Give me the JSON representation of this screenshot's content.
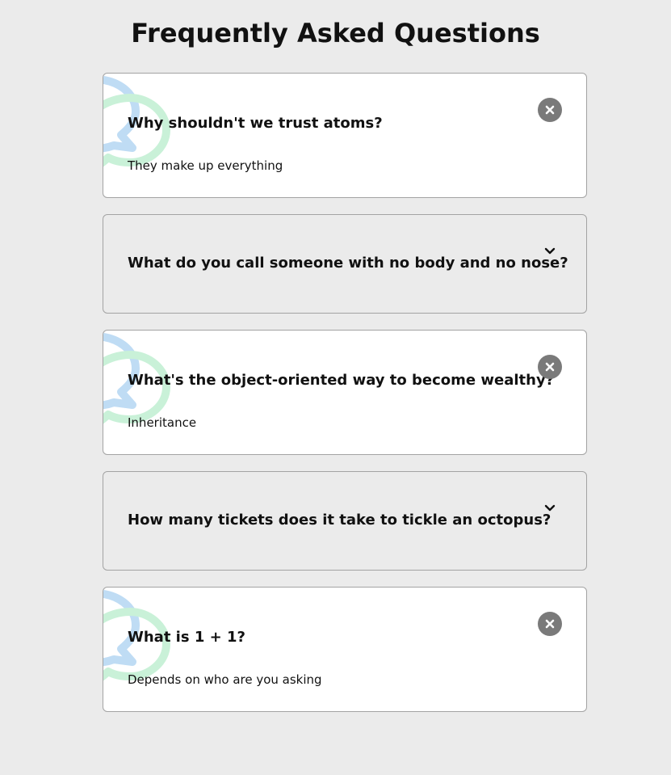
{
  "page": {
    "title": "Frequently Asked Questions"
  },
  "colors": {
    "background": "#ebebeb",
    "card_active_bg": "#ffffff",
    "card_border": "#a3a3a3",
    "toggle_close_bg": "#7a7a7a",
    "bubble_blue": "#bfdcf4",
    "bubble_green": "#c9f1d8",
    "text": "#111111"
  },
  "faq": {
    "items": [
      {
        "question": "Why shouldn't we trust atoms?",
        "answer": "They make up everything",
        "state": "expanded",
        "toggle_icon": "close-icon"
      },
      {
        "question": "What do you call someone with no body and no nose?",
        "answer": "",
        "state": "collapsed",
        "toggle_icon": "chevron-down-icon"
      },
      {
        "question": "What's the object-oriented way to become wealthy?",
        "answer": "Inheritance",
        "state": "expanded",
        "toggle_icon": "close-icon"
      },
      {
        "question": "How many tickets does it take to tickle an octopus?",
        "answer": "",
        "state": "collapsed",
        "toggle_icon": "chevron-down-icon"
      },
      {
        "question": "What is 1 + 1?",
        "answer": "Depends on who are you asking",
        "state": "expanded",
        "toggle_icon": "close-icon"
      }
    ]
  }
}
